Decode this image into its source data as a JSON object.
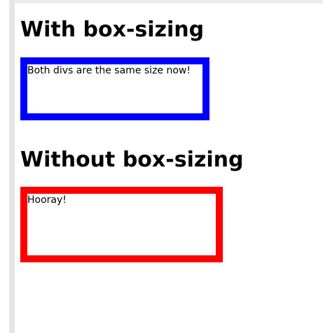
{
  "headings": {
    "with": "With box-sizing",
    "without": "Without box-sizing"
  },
  "boxes": {
    "with_text": "Both divs are the same size now!",
    "without_text": "Hooray!"
  },
  "colors": {
    "with_border": "#0000ff",
    "without_border": "#ff0000"
  }
}
